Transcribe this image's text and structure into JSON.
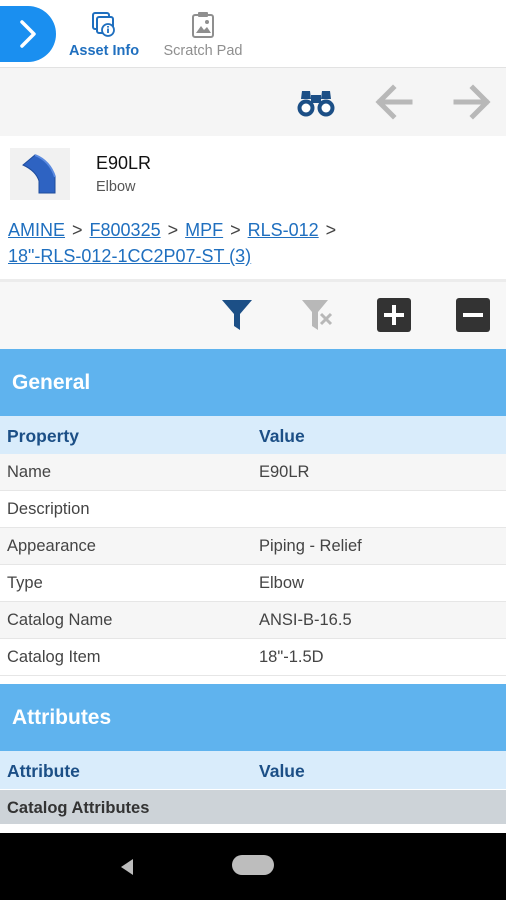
{
  "tabs": {
    "asset_info": "Asset Info",
    "scratch_pad": "Scratch Pad"
  },
  "asset": {
    "name": "E90LR",
    "type": "Elbow"
  },
  "breadcrumb": [
    "AMINE",
    "F800325",
    "MPF",
    "RLS-012",
    "18\"-RLS-012-1CC2P07-ST (3)"
  ],
  "general": {
    "title": "General",
    "col_property": "Property",
    "col_value": "Value",
    "rows": [
      {
        "property": "Name",
        "value": "E90LR"
      },
      {
        "property": "Description",
        "value": ""
      },
      {
        "property": "Appearance",
        "value": "Piping - Relief"
      },
      {
        "property": "Type",
        "value": "Elbow"
      },
      {
        "property": "Catalog Name",
        "value": "ANSI-B-16.5"
      },
      {
        "property": "Catalog Item",
        "value": "18\"-1.5D"
      }
    ]
  },
  "attributes": {
    "title": "Attributes",
    "col_attribute": "Attribute",
    "col_value": "Value",
    "group": "Catalog Attributes"
  },
  "colors": {
    "accent": "#1a8ff0",
    "section_header": "#5fb3ee",
    "column_header": "#d9ecfb",
    "icon_dark": "#1c4f86"
  }
}
